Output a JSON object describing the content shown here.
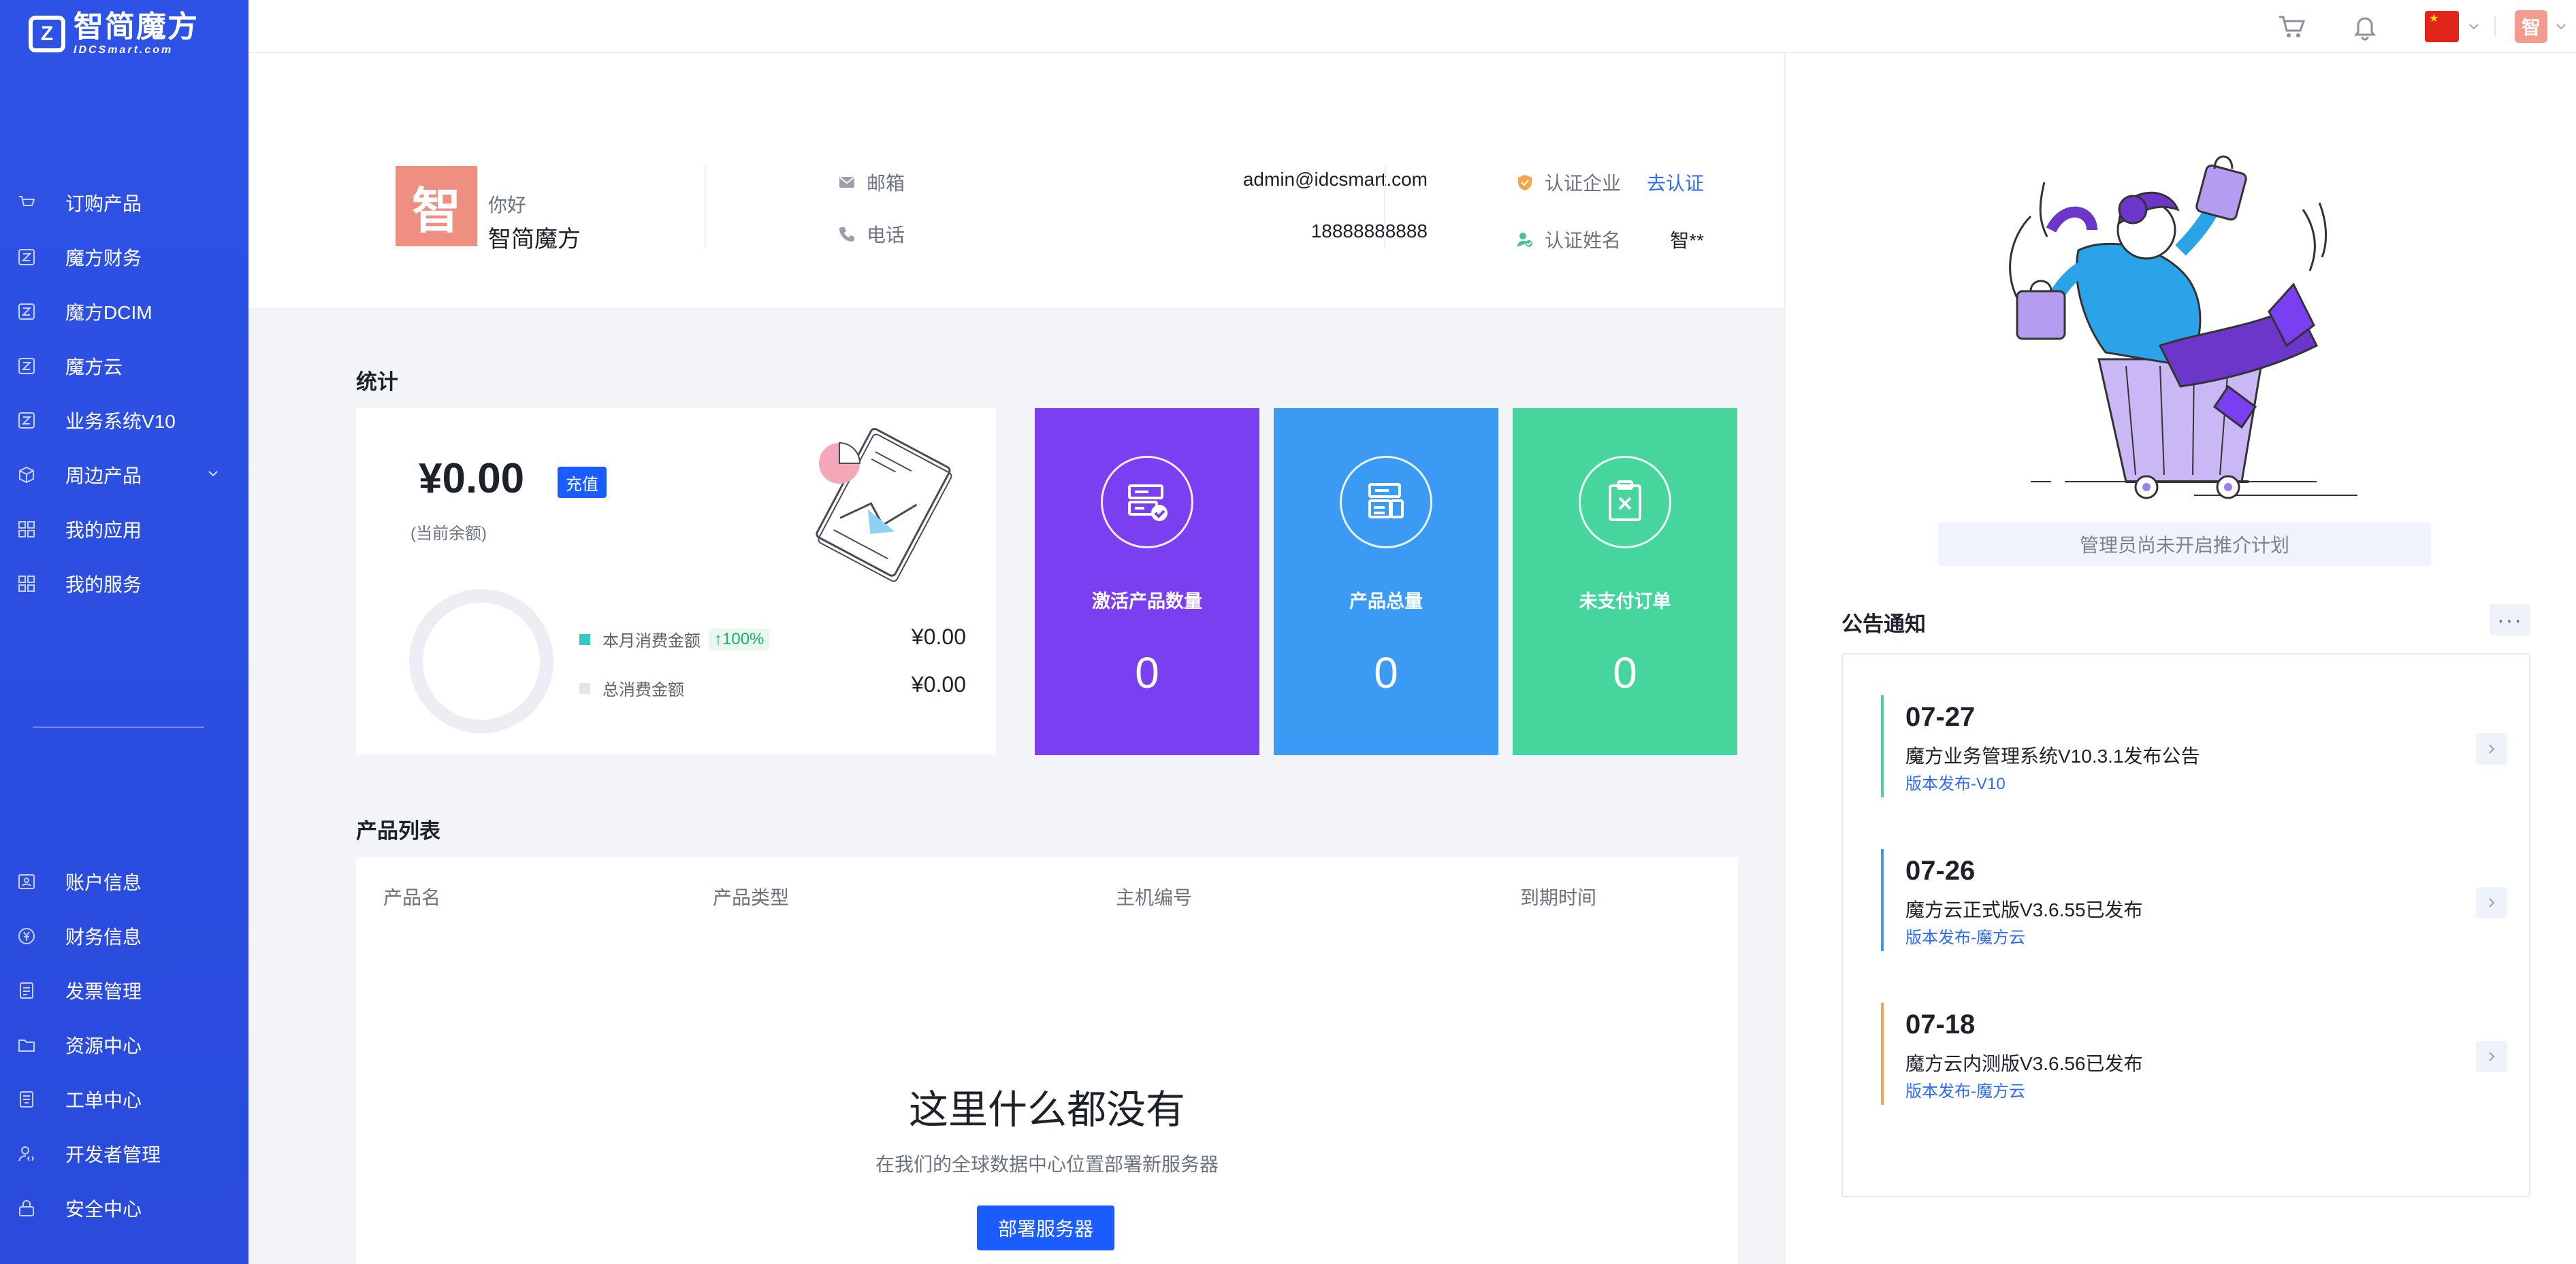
{
  "brand": {
    "name_cn": "智简魔方",
    "name_en": "IDCSmart.com",
    "mark": "Z"
  },
  "sidebar": {
    "top_items": [
      {
        "label": "订购产品",
        "icon": "cart-icon"
      },
      {
        "label": "魔方财务",
        "icon": "brand-z-icon"
      },
      {
        "label": "魔方DCIM",
        "icon": "brand-z-icon"
      },
      {
        "label": "魔方云",
        "icon": "brand-z-icon"
      },
      {
        "label": "业务系统V10",
        "icon": "brand-z-icon"
      },
      {
        "label": "周边产品",
        "icon": "cube-icon"
      },
      {
        "label": "我的应用",
        "icon": "grid-icon"
      },
      {
        "label": "我的服务",
        "icon": "grid-icon"
      }
    ],
    "bottom_items": [
      {
        "label": "账户信息",
        "icon": "user-card-icon"
      },
      {
        "label": "财务信息",
        "icon": "yen-icon"
      },
      {
        "label": "发票管理",
        "icon": "invoice-icon"
      },
      {
        "label": "资源中心",
        "icon": "folder-icon"
      },
      {
        "label": "工单中心",
        "icon": "ticket-icon"
      },
      {
        "label": "开发者管理",
        "icon": "developer-icon"
      },
      {
        "label": "安全中心",
        "icon": "lock-icon"
      }
    ]
  },
  "topbar": {
    "avatar_char": "智"
  },
  "profile": {
    "avatar_char": "智",
    "greeting": "你好",
    "username": "智简魔方",
    "email_label": "邮箱",
    "email": "admin@idcsmart.com",
    "phone_label": "电话",
    "phone": "18888888888",
    "company_label": "认证企业",
    "company_action": "去认证",
    "realname_label": "认证姓名",
    "realname": "智**"
  },
  "stats": {
    "title": "统计",
    "balance": "¥0.00",
    "recharge_label": "充值",
    "balance_note": "(当前余额)",
    "month_label": "本月消费金额",
    "month_pct": "↑100%",
    "month_value": "¥0.00",
    "total_label": "总消费金额",
    "total_value": "¥0.00",
    "tiles": [
      {
        "label": "激活产品数量",
        "value": "0",
        "color": "#7a3ff1",
        "icon": "active-products-icon"
      },
      {
        "label": "产品总量",
        "value": "0",
        "color": "#3b9bf4",
        "icon": "products-total-icon"
      },
      {
        "label": "未支付订单",
        "value": "0",
        "color": "#46d59d",
        "icon": "unpaid-order-icon"
      }
    ]
  },
  "products": {
    "title": "产品列表",
    "columns": [
      "产品名",
      "产品类型",
      "主机编号",
      "到期时间"
    ],
    "empty_title": "这里什么都没有",
    "empty_sub": "在我们的全球数据中心位置部署新服务器",
    "deploy_label": "部署服务器"
  },
  "right": {
    "referral": "管理员尚未开启推介计划",
    "announce_title": "公告通知",
    "more": "···",
    "items": [
      {
        "date": "07-27",
        "title": "魔方业务管理系统V10.3.1发布公告",
        "category": "版本发布-V10",
        "color": "#46d59d"
      },
      {
        "date": "07-26",
        "title": "魔方云正式版V3.6.55已发布",
        "category": "版本发布-魔方云",
        "color": "#3b9bf4"
      },
      {
        "date": "07-18",
        "title": "魔方云内测版V3.6.56已发布",
        "category": "版本发布-魔方云",
        "color": "#f5a64a"
      }
    ]
  }
}
